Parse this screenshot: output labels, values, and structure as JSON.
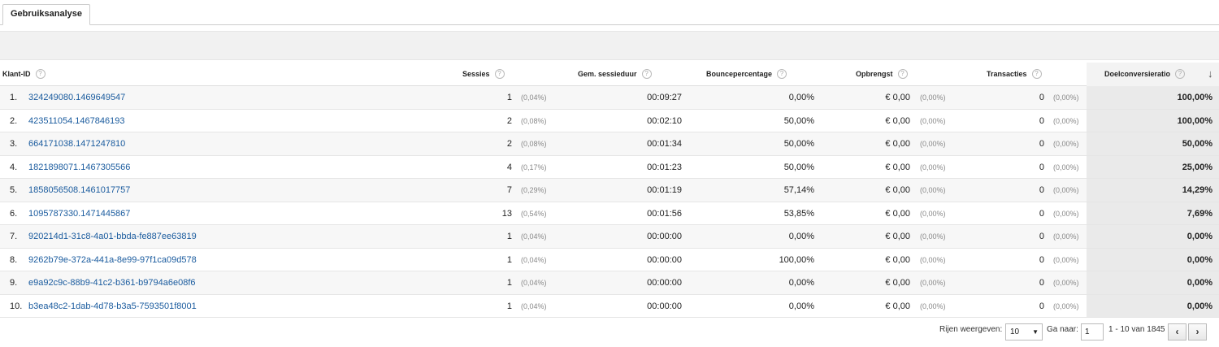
{
  "tab": {
    "label": "Gebruiksanalyse"
  },
  "columns": {
    "client_id": "Klant-ID",
    "sessions": "Sessies",
    "avg_duration": "Gem. sessieduur",
    "bounce": "Bouncepercentage",
    "revenue": "Opbrengst",
    "transactions": "Transacties",
    "goal_conv": "Doelconversieratio"
  },
  "help_glyph": "?",
  "sort_glyph": "↓",
  "rows": [
    {
      "idx": "1.",
      "id": "324249080.1469649547",
      "sessions": "1",
      "sessions_pct": "(0,04%)",
      "duration": "00:09:27",
      "bounce": "0,00%",
      "revenue": "€ 0,00",
      "revenue_pct": "(0,00%)",
      "transactions": "0",
      "transactions_pct": "(0,00%)",
      "goal": "100,00%"
    },
    {
      "idx": "2.",
      "id": "423511054.1467846193",
      "sessions": "2",
      "sessions_pct": "(0,08%)",
      "duration": "00:02:10",
      "bounce": "50,00%",
      "revenue": "€ 0,00",
      "revenue_pct": "(0,00%)",
      "transactions": "0",
      "transactions_pct": "(0,00%)",
      "goal": "100,00%"
    },
    {
      "idx": "3.",
      "id": "664171038.1471247810",
      "sessions": "2",
      "sessions_pct": "(0,08%)",
      "duration": "00:01:34",
      "bounce": "50,00%",
      "revenue": "€ 0,00",
      "revenue_pct": "(0,00%)",
      "transactions": "0",
      "transactions_pct": "(0,00%)",
      "goal": "50,00%"
    },
    {
      "idx": "4.",
      "id": "1821898071.1467305566",
      "sessions": "4",
      "sessions_pct": "(0,17%)",
      "duration": "00:01:23",
      "bounce": "50,00%",
      "revenue": "€ 0,00",
      "revenue_pct": "(0,00%)",
      "transactions": "0",
      "transactions_pct": "(0,00%)",
      "goal": "25,00%"
    },
    {
      "idx": "5.",
      "id": "1858056508.1461017757",
      "sessions": "7",
      "sessions_pct": "(0,29%)",
      "duration": "00:01:19",
      "bounce": "57,14%",
      "revenue": "€ 0,00",
      "revenue_pct": "(0,00%)",
      "transactions": "0",
      "transactions_pct": "(0,00%)",
      "goal": "14,29%"
    },
    {
      "idx": "6.",
      "id": "1095787330.1471445867",
      "sessions": "13",
      "sessions_pct": "(0,54%)",
      "duration": "00:01:56",
      "bounce": "53,85%",
      "revenue": "€ 0,00",
      "revenue_pct": "(0,00%)",
      "transactions": "0",
      "transactions_pct": "(0,00%)",
      "goal": "7,69%"
    },
    {
      "idx": "7.",
      "id": "920214d1-31c8-4a01-bbda-fe887ee63819",
      "sessions": "1",
      "sessions_pct": "(0,04%)",
      "duration": "00:00:00",
      "bounce": "0,00%",
      "revenue": "€ 0,00",
      "revenue_pct": "(0,00%)",
      "transactions": "0",
      "transactions_pct": "(0,00%)",
      "goal": "0,00%"
    },
    {
      "idx": "8.",
      "id": "9262b79e-372a-441a-8e99-97f1ca09d578",
      "sessions": "1",
      "sessions_pct": "(0,04%)",
      "duration": "00:00:00",
      "bounce": "100,00%",
      "revenue": "€ 0,00",
      "revenue_pct": "(0,00%)",
      "transactions": "0",
      "transactions_pct": "(0,00%)",
      "goal": "0,00%"
    },
    {
      "idx": "9.",
      "id": "e9a92c9c-88b9-41c2-b361-b9794a6e08f6",
      "sessions": "1",
      "sessions_pct": "(0,04%)",
      "duration": "00:00:00",
      "bounce": "0,00%",
      "revenue": "€ 0,00",
      "revenue_pct": "(0,00%)",
      "transactions": "0",
      "transactions_pct": "(0,00%)",
      "goal": "0,00%"
    },
    {
      "idx": "10.",
      "id": "b3ea48c2-1dab-4d78-b3a5-7593501f8001",
      "sessions": "1",
      "sessions_pct": "(0,04%)",
      "duration": "00:00:00",
      "bounce": "0,00%",
      "revenue": "€ 0,00",
      "revenue_pct": "(0,00%)",
      "transactions": "0",
      "transactions_pct": "(0,00%)",
      "goal": "0,00%"
    }
  ],
  "pager": {
    "rows_label": "Rijen weergeven:",
    "rows_value": "10",
    "goto_label": "Ga naar:",
    "goto_value": "1",
    "range": "1 - 10 van 1845",
    "prev": "‹",
    "next": "›"
  },
  "colors": {
    "link": "#1a5b9e",
    "highlight_column": "#eaeaea"
  }
}
